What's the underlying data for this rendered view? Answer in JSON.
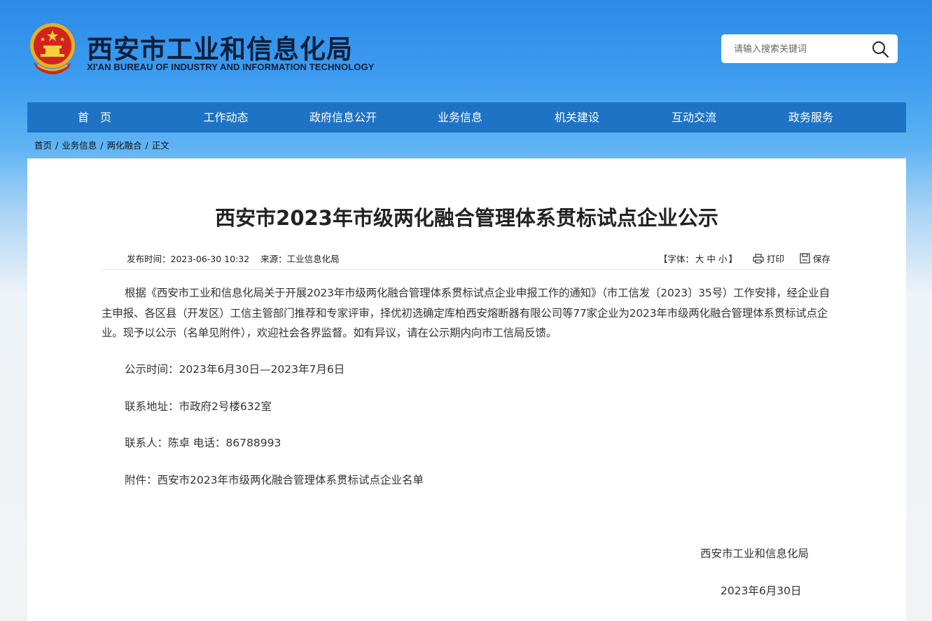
{
  "header": {
    "title_cn": "西安市工业和信息化局",
    "title_en": "XI'AN BUREAU OF INDUSTRY AND INFORMATION TECHNOLOGY",
    "emblem_icon": "national-emblem-icon"
  },
  "search": {
    "placeholder": "请输入搜索关键词",
    "icon": "search-icon"
  },
  "nav": {
    "items": [
      "首　页",
      "工作动态",
      "政府信息公开",
      "业务信息",
      "机关建设",
      "互动交流",
      "政务服务"
    ]
  },
  "breadcrumb": {
    "items": [
      "首页",
      "业务信息",
      "两化融合",
      "正文"
    ],
    "separator": "/"
  },
  "article": {
    "title": "西安市2023年市级两化融合管理体系贯标试点企业公示",
    "publish_label": "发布时间：",
    "publish_time": "2023-06-30 10:32",
    "source_label": "来源：",
    "source": "工业信息化局",
    "font_label": "【字体：",
    "font_large": "大",
    "font_medium": "中",
    "font_small": "小",
    "font_close": "】",
    "print_label": "打印",
    "save_label": "保存",
    "paragraph1": "根据《西安市工业和信息化局关于开展2023年市级两化融合管理体系贯标试点企业申报工作的通知》（市工信发〔2023〕35号）工作安排，经企业自主申报、各区县（开发区）工信主管部门推荐和专家评审，择优初选确定库柏西安熔断器有限公司等77家企业为2023年市级两化融合管理体系贯标试点企业。现予以公示（名单见附件），欢迎社会各界监督。如有异议，请在公示期内向市工信局反馈。",
    "period": "公示时间：2023年6月30日—2023年7月6日",
    "address": "联系地址：市政府2号楼632室",
    "contact": "联系人：陈卓 电话：86788993",
    "attachment_label": "附件：",
    "attachment": "西安市2023年市级两化融合管理体系贯标试点企业名单",
    "signature_org": "西安市工业和信息化局",
    "signature_date": "2023年6月30日"
  },
  "colors": {
    "nav_bg": "#1e73c4",
    "header_bg": "#2b8be8",
    "page_bg": "#f2f3f5"
  }
}
